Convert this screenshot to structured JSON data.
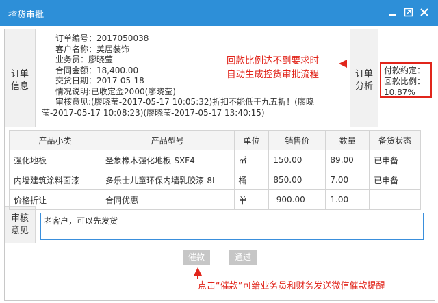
{
  "window": {
    "title": "控货审批"
  },
  "order": {
    "section_label": "订单信息",
    "fields": [
      "订单编号：2017050038",
      "客户名称：美居装饰",
      "业务员：廖晓莹",
      "合同金额：18,400.00",
      "交货日期：2017-05-18",
      "情况说明:已收定金2000(廖晓莹)",
      "审核意见:(廖晓莹-2017-05-17 10:05:32)折扣不能低于九五折！(廖晓",
      "莹-2017-05-17 10:08:23)(廖晓莹-2017-05-17 13:40:15)"
    ]
  },
  "analysis": {
    "section_label": "订单分析",
    "payment_terms": "付款约定：",
    "payback_label": "回款比例：",
    "payback_value": "10.87%"
  },
  "annotations": {
    "top_line1": "回款比例达不到要求时",
    "top_line2": "自动生成控货审批流程",
    "bottom": "点击“催款”可给业务员和财务发送微信催款提醒"
  },
  "products": {
    "headers": [
      "产品小类",
      "产品型号",
      "单位",
      "销售价",
      "数量",
      "备货状态"
    ],
    "rows": [
      [
        "强化地板",
        "圣象橡木强化地板-SXF4",
        "㎡",
        "150.00",
        "89.00",
        "已申备"
      ],
      [
        "内墙建筑涂料面漆",
        "多乐士儿童环保内墙乳胶漆-8L",
        "桶",
        "850.00",
        "7.00",
        "已申备"
      ],
      [
        "价格折让",
        "合同优惠",
        "单",
        "-900.00",
        "1.00",
        ""
      ]
    ]
  },
  "audit": {
    "section_label": "审核意见",
    "value": "老客户，可以先发货"
  },
  "actions": {
    "remind_label": "催款",
    "approve_label": "通过"
  },
  "colors": {
    "titlebar": "#2d8fd8",
    "annotation": "#e1251b",
    "button": "#c6c6c6"
  }
}
